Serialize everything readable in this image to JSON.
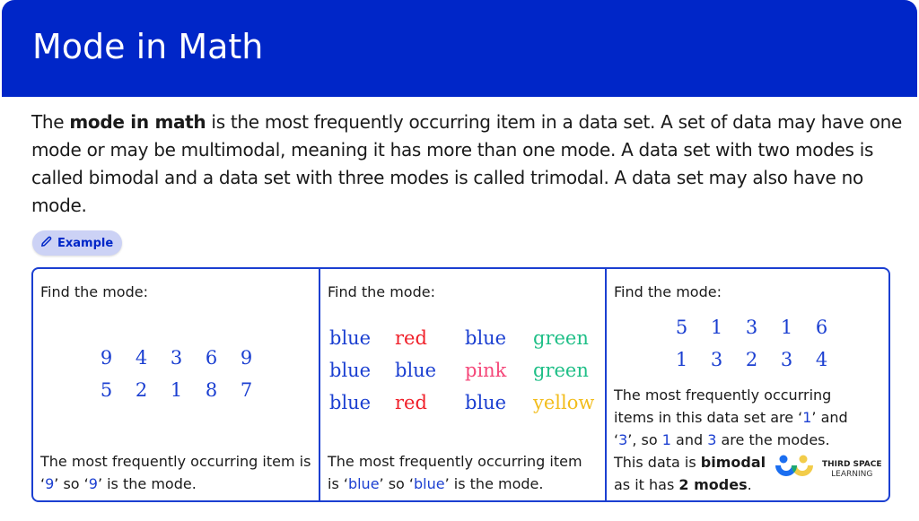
{
  "header": {
    "title": "Mode in Math"
  },
  "intro": {
    "prefix": "The ",
    "bold_term": "mode in math",
    "text": " is the most frequently occurring item in a data set. A set of data may have one mode or may be multimodal, meaning it has more than one mode. A data set with two modes is called bimodal and a data set with three modes is called trimodal. A data set may also have no mode."
  },
  "badge": {
    "icon": "pencil-icon",
    "label": "Example"
  },
  "examples": [
    {
      "prompt": "Find the mode:",
      "values": [
        "9",
        "4",
        "3",
        "6",
        "9",
        "5",
        "2",
        "1",
        "8",
        "7"
      ],
      "answer": {
        "t1": "The most frequently occurring item is ‘",
        "v1": "9",
        "t2": "’ so ‘",
        "v2": "9",
        "t3": "’ is the mode."
      }
    },
    {
      "prompt": "Find the mode:",
      "words": [
        {
          "text": "blue",
          "color": "#1b3fd1"
        },
        {
          "text": "red",
          "color": "#f0202a"
        },
        {
          "text": "blue",
          "color": "#1b3fd1"
        },
        {
          "text": "green",
          "color": "#1fbf87"
        },
        {
          "text": "blue",
          "color": "#1b3fd1"
        },
        {
          "text": "blue",
          "color": "#1b3fd1"
        },
        {
          "text": "pink",
          "color": "#f5487a"
        },
        {
          "text": "green",
          "color": "#1fbf87"
        },
        {
          "text": "blue",
          "color": "#1b3fd1"
        },
        {
          "text": "red",
          "color": "#f0202a"
        },
        {
          "text": "blue",
          "color": "#1b3fd1"
        },
        {
          "text": "yellow",
          "color": "#f2bd1d"
        }
      ],
      "answer": {
        "t1": "The most frequently occurring item is ‘",
        "v1": "blue",
        "t2": "’ so ‘",
        "v2": "blue",
        "t3": "’ is the mode."
      }
    },
    {
      "prompt": "Find the mode:",
      "values": [
        "5",
        "1",
        "3",
        "1",
        "6",
        "1",
        "3",
        "2",
        "3",
        "4"
      ],
      "answer": {
        "t1": "The most frequently occurring items in this data set are ‘",
        "v1": "1",
        "t2": "’ and ‘",
        "v2": "3",
        "t3": "’, so ",
        "v3": "1",
        "t4": " and ",
        "v4": "3",
        "t5": " are the modes.",
        "t6": "This data is ",
        "b1": "bimodal",
        "t7": "as it has ",
        "b2": "2 modes",
        "t8": "."
      }
    }
  ],
  "logo": {
    "line1": "THIRD SPACE",
    "line2": "LEARNING"
  }
}
